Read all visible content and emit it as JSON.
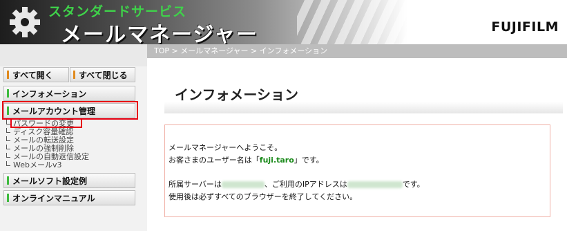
{
  "header": {
    "service_name": "スタンダードサービス",
    "app_name": "メールマネージャー",
    "brand": "FUJIFILM"
  },
  "sidebar": {
    "expand_all": "すべて開く",
    "collapse_all": "すべて閉じる",
    "items": [
      {
        "label": "インフォメーション"
      },
      {
        "label": "メールアカウント管理"
      },
      {
        "label": "メールソフト設定例"
      },
      {
        "label": "オンラインマニュアル"
      }
    ],
    "account_subitems": [
      "パスワードの変更",
      "ディスク容量確認",
      "メールの転送設定",
      "メールの強制削除",
      "メールの自動返信設定",
      "Webメールv3"
    ]
  },
  "breadcrumb": "TOP > メールマネージャー > インフォメーション",
  "main": {
    "title": "インフォメーション",
    "welcome": "メールマネージャーへようこそ。",
    "user_prefix": "お客さまのユーザー名は「",
    "username": "fuji.taro",
    "user_suffix": "」です。",
    "server_prefix": "所属サーバーは",
    "server_mid": "、ご利用のIPアドレスは",
    "server_suffix": "です。",
    "logout_notice": "使用後は必ずすべてのブラウザーを終了してください。"
  },
  "colors": {
    "accent_green": "#3dbb3d",
    "accent_orange": "#e08a1e",
    "highlight_red": "#e60012"
  }
}
